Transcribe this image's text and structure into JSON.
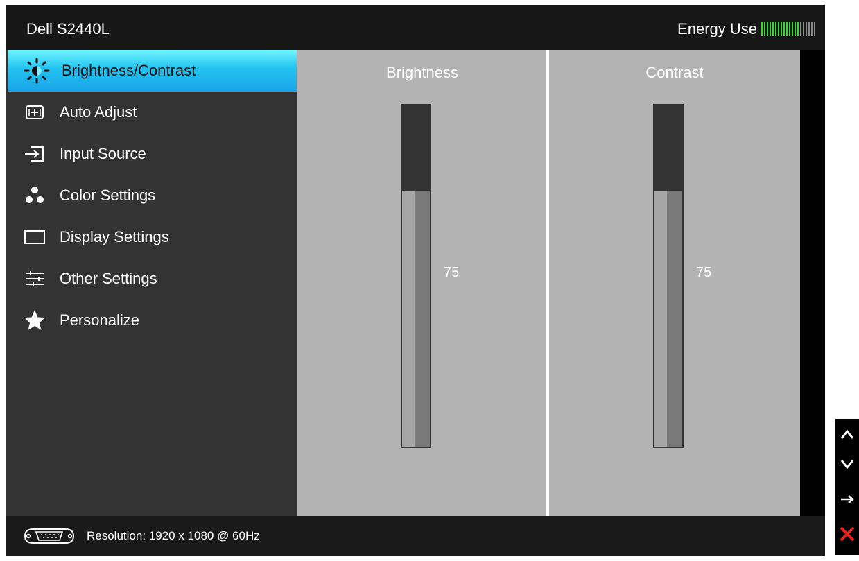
{
  "header": {
    "model": "Dell S2440L",
    "energy_label": "Energy Use",
    "energy_level": 0.7
  },
  "menu": {
    "items": [
      {
        "label": "Brightness/Contrast",
        "icon": "brightness-icon",
        "active": true
      },
      {
        "label": "Auto Adjust",
        "icon": "auto-adjust-icon",
        "active": false
      },
      {
        "label": "Input Source",
        "icon": "input-source-icon",
        "active": false
      },
      {
        "label": "Color Settings",
        "icon": "color-settings-icon",
        "active": false
      },
      {
        "label": "Display Settings",
        "icon": "display-settings-icon",
        "active": false
      },
      {
        "label": "Other Settings",
        "icon": "other-settings-icon",
        "active": false
      },
      {
        "label": "Personalize",
        "icon": "star-icon",
        "active": false
      }
    ]
  },
  "brightness": {
    "title": "Brightness",
    "value": "75",
    "level": 0.75
  },
  "contrast": {
    "title": "Contrast",
    "value": "75",
    "level": 0.75
  },
  "footer": {
    "resolution": "Resolution: 1920 x 1080 @ 60Hz",
    "connector_icon": "vga-connector-icon"
  },
  "side_buttons": [
    "up-arrow-icon",
    "down-arrow-icon",
    "enter-arrow-icon",
    "exit-x-icon"
  ],
  "colors": {
    "accent": "#22c3f0",
    "energy_on": "#3bd431",
    "exit": "#e8231e",
    "panel": "#b3b3b3",
    "sidebar": "#333333"
  }
}
